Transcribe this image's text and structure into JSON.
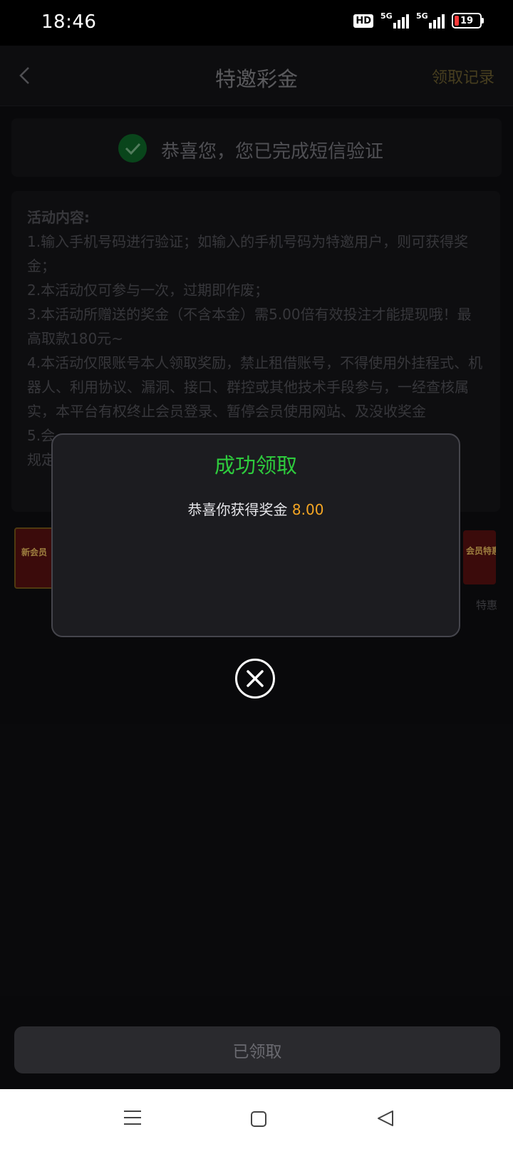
{
  "status_bar": {
    "time": "18:46",
    "hd_label": "HD",
    "net1": "5G",
    "net2": "5G",
    "battery": "19",
    "battery_level": 0.19
  },
  "header": {
    "title": "特邀彩金",
    "right_link": "领取记录"
  },
  "verify": {
    "text": "恭喜您，您已完成短信验证"
  },
  "rules": {
    "heading": "活动内容:",
    "items": [
      "1.输入手机号码进行验证；如输入的手机号码为特邀用户，则可获得奖金；",
      "2.本活动仅可参与一次，过期即作废；",
      "3.本活动所赠送的奖金（不含本金）需5.00倍有效投注才能提现哦！最高取款180元~",
      "4.本活动仅限账号本人领取奖励，禁止租借账号，不得使用外挂程式、机器人、利用协议、漏洞、接口、群控或其他技术手段参与，一经查核属实，本平台有权终止会员登录、暂停会员使用网站、及没收奖金",
      "5.会",
      "规定"
    ]
  },
  "banners": {
    "left_text": "新会员",
    "right_text": "会员特惠",
    "right_caption": "特惠"
  },
  "modal": {
    "title": "成功领取",
    "body_prefix": "恭喜你获得奖金",
    "amount": "8.00"
  },
  "bottom_button": {
    "label": "已领取"
  },
  "colors": {
    "success_green": "#2ecb3d",
    "amount_orange": "#f5a623",
    "battery_red": "#ff3b3b"
  }
}
